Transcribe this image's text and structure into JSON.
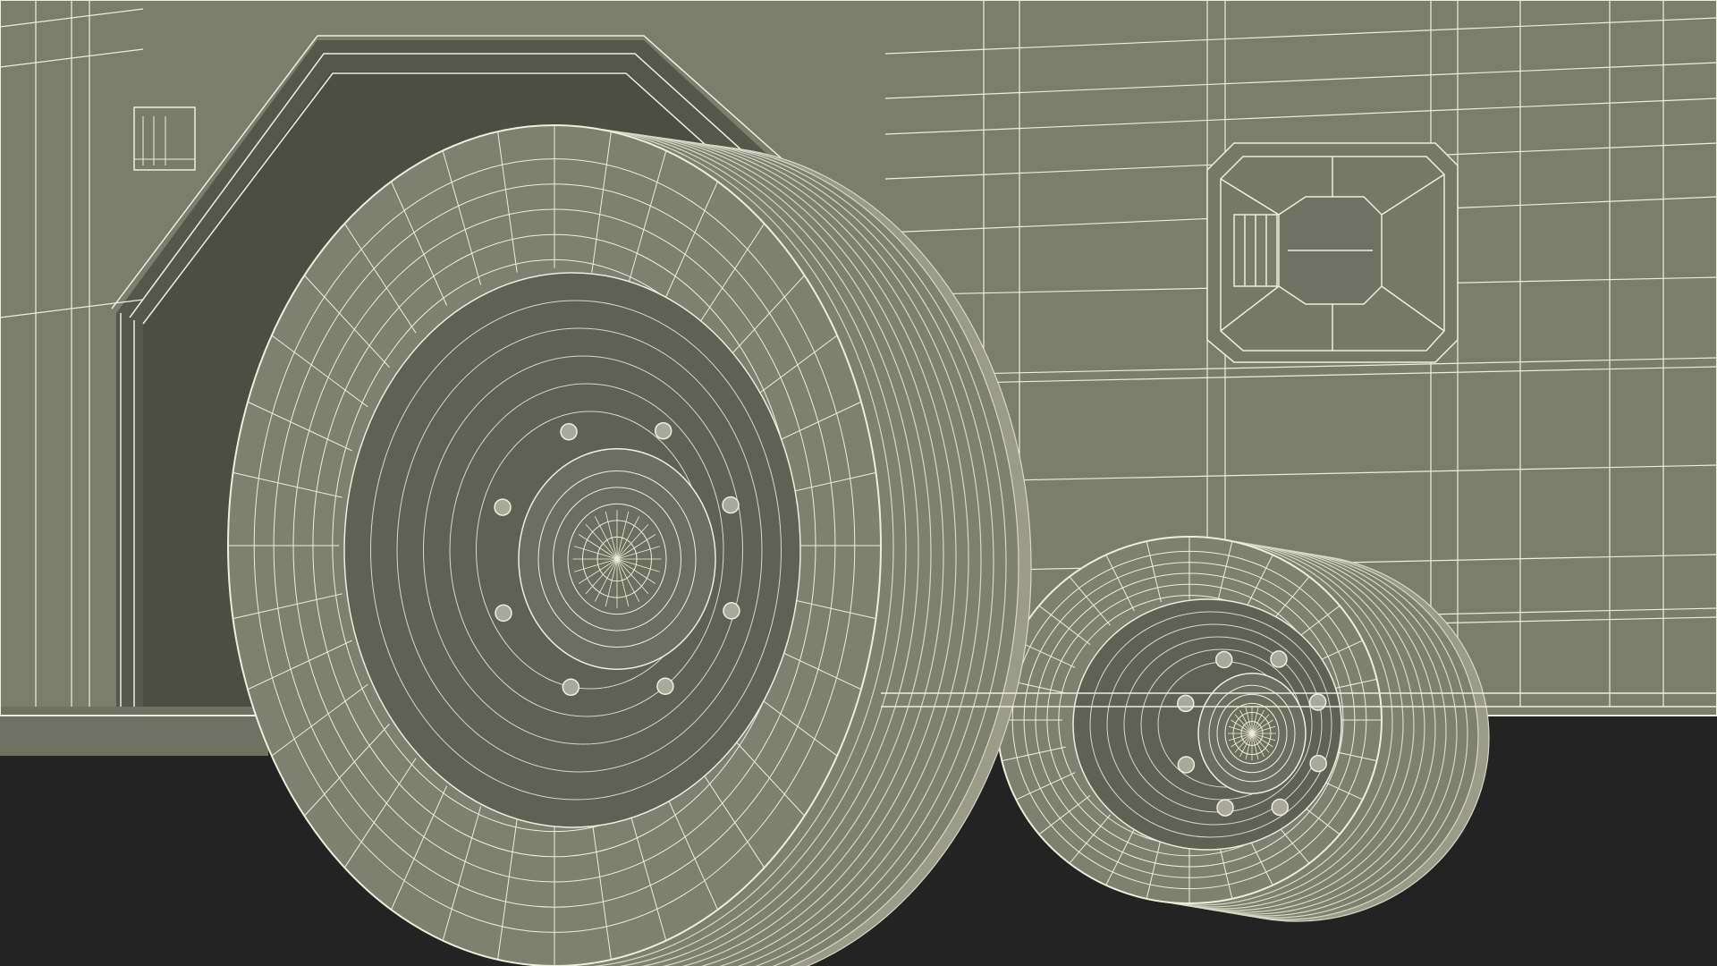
{
  "scene": {
    "subject": "truck-rear-wheels-wireframe",
    "colors": {
      "ground": "#232323",
      "body": "#7c7e6d",
      "body_shadow": "#696b5c",
      "arch_inner": "#4e5045",
      "wire": "#eeeedd",
      "wire_dim": "#d8d8c8",
      "tire": "#7f8170",
      "tire_dark": "#5f6154",
      "bolt": "#a8a998"
    },
    "wheels": [
      {
        "name": "front-wheel",
        "bolt_count": 8,
        "tread_rings": 12,
        "spokes": 36
      },
      {
        "name": "rear-wheel",
        "bolt_count": 8,
        "tread_rings": 10,
        "spokes": 28
      }
    ]
  }
}
